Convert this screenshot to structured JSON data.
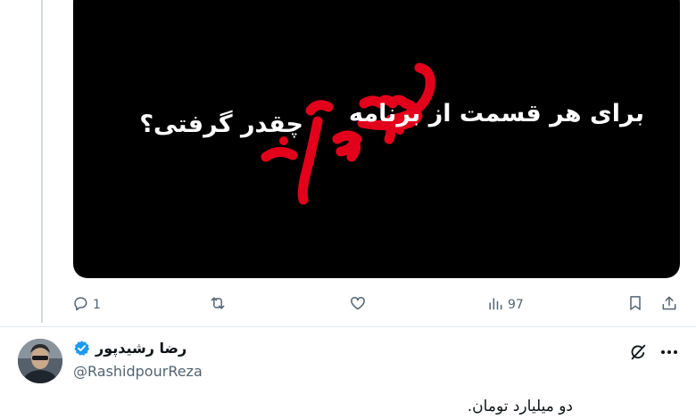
{
  "media": {
    "line1": "برای هر قسمت از برنامه",
    "line2": "چقدر گرفتی؟",
    "logo_text": "سیم آخر",
    "logo_color": "#e3001b"
  },
  "actions": {
    "reply_count": "1",
    "views_count": "97"
  },
  "reply_tweet": {
    "name": "رضا رشیدپور",
    "handle": "@RashidpourReza",
    "text": "دو میلیارد تومان."
  },
  "icons": [
    "reply-icon",
    "retweet-icon",
    "like-icon",
    "views-icon",
    "bookmark-icon",
    "share-icon",
    "verified-icon",
    "grok-icon",
    "more-icon"
  ],
  "colors": {
    "text": "#0f1419",
    "muted": "#536471",
    "verified": "#1d9bf0",
    "thread_line": "#cfd9de"
  }
}
